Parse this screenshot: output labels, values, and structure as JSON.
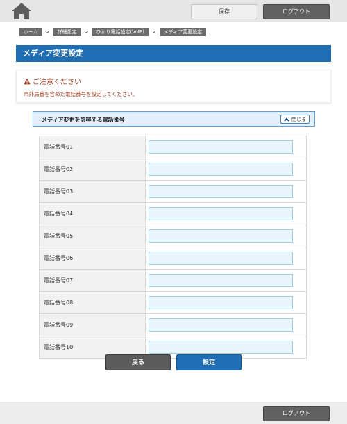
{
  "header": {
    "home_icon": "home-icon",
    "save_label": "保存",
    "logout_label": "ログアウト"
  },
  "breadcrumb": [
    "ホーム",
    "詳細設定",
    "ひかり電話設定(VoIP)",
    "メディア変更設定"
  ],
  "breadcrumb_separator": ">",
  "page_title": "メディア変更設定",
  "notice": {
    "icon": "warning-icon",
    "title": "ご注意ください",
    "text": "市外局番を含めた電話番号を設定してください。"
  },
  "section": {
    "title": "メディア変更を許容する電話番号",
    "close_label": "閉じる",
    "close_icon": "chevron-up-icon"
  },
  "phones": [
    {
      "label": "電話番号01",
      "value": ""
    },
    {
      "label": "電話番号02",
      "value": ""
    },
    {
      "label": "電話番号03",
      "value": ""
    },
    {
      "label": "電話番号04",
      "value": ""
    },
    {
      "label": "電話番号05",
      "value": ""
    },
    {
      "label": "電話番号06",
      "value": ""
    },
    {
      "label": "電話番号07",
      "value": ""
    },
    {
      "label": "電話番号08",
      "value": ""
    },
    {
      "label": "電話番号09",
      "value": ""
    },
    {
      "label": "電話番号10",
      "value": ""
    }
  ],
  "actions": {
    "back_label": "戻る",
    "set_label": "設定"
  },
  "footer": {
    "logout_label": "ログアウト"
  },
  "colors": {
    "primary": "#1f6db3",
    "dark_button": "#5c5c5c",
    "warning_text": "#9b3a1e",
    "input_bg": "#e8f6fc"
  }
}
